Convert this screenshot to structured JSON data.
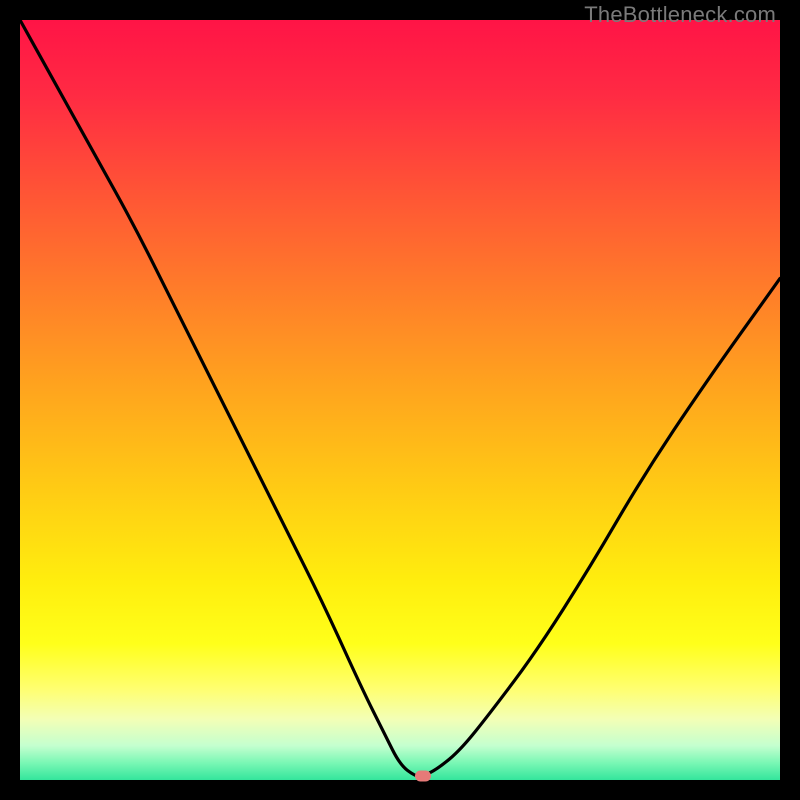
{
  "watermark": "TheBottleneck.com",
  "colors": {
    "gradient_stops": [
      {
        "offset": 0.0,
        "color": "#ff1446"
      },
      {
        "offset": 0.1,
        "color": "#ff2b43"
      },
      {
        "offset": 0.22,
        "color": "#ff5236"
      },
      {
        "offset": 0.35,
        "color": "#ff7b2a"
      },
      {
        "offset": 0.48,
        "color": "#ffa31e"
      },
      {
        "offset": 0.62,
        "color": "#ffcc14"
      },
      {
        "offset": 0.74,
        "color": "#ffee0e"
      },
      {
        "offset": 0.82,
        "color": "#ffff1a"
      },
      {
        "offset": 0.88,
        "color": "#ffff70"
      },
      {
        "offset": 0.92,
        "color": "#f3ffb6"
      },
      {
        "offset": 0.955,
        "color": "#c4ffcf"
      },
      {
        "offset": 0.978,
        "color": "#78f7b4"
      },
      {
        "offset": 1.0,
        "color": "#34e59c"
      }
    ],
    "curve_stroke": "#000000",
    "marker_fill": "#e67a78"
  },
  "chart_data": {
    "type": "line",
    "title": "",
    "xlabel": "",
    "ylabel": "",
    "xlim": [
      0,
      100
    ],
    "ylim": [
      0,
      100
    ],
    "grid": false,
    "series": [
      {
        "name": "bottleneck-curve",
        "x": [
          0,
          5,
          10,
          15,
          20,
          25,
          30,
          35,
          40,
          45,
          48,
          50,
          52,
          53,
          55,
          58,
          62,
          68,
          75,
          82,
          90,
          100
        ],
        "y": [
          100,
          91,
          82,
          73,
          63,
          53,
          43,
          33,
          23,
          12,
          6,
          2,
          0.5,
          0.5,
          1.5,
          4,
          9,
          17,
          28,
          40,
          52,
          66
        ]
      }
    ],
    "marker": {
      "x": 53,
      "y": 0.5
    },
    "note": "Axis ranges are implied (0–100); no tick labels are shown in the source image."
  }
}
